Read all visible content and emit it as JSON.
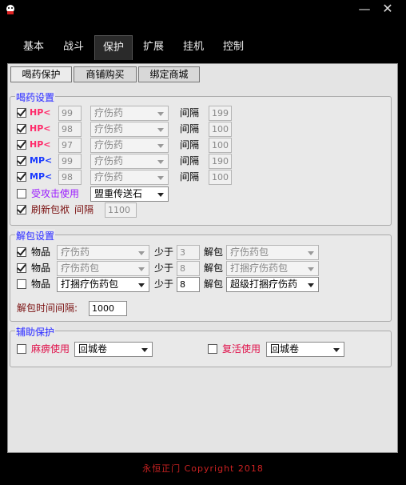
{
  "window": {
    "minimize_glyph": "—",
    "close_glyph": "✕"
  },
  "main_tabs": [
    "基本",
    "战斗",
    "保护",
    "扩展",
    "挂机",
    "控制"
  ],
  "sub_tabs": [
    "喝药保护",
    "商铺购买",
    "绑定商城"
  ],
  "potion": {
    "legend": "喝药设置",
    "interval_label": "间隔",
    "rows": [
      {
        "checked": true,
        "kind": "HP",
        "icon": "HP<",
        "threshold": "99",
        "item": "疗伤药",
        "interval": "199"
      },
      {
        "checked": true,
        "kind": "HP",
        "icon": "HP<",
        "threshold": "98",
        "item": "疗伤药",
        "interval": "100"
      },
      {
        "checked": true,
        "kind": "HP",
        "icon": "HP<",
        "threshold": "97",
        "item": "疗伤药",
        "interval": "100"
      },
      {
        "checked": true,
        "kind": "MP",
        "icon": "MP<",
        "threshold": "99",
        "item": "疗伤药",
        "interval": "190"
      },
      {
        "checked": true,
        "kind": "MP",
        "icon": "MP<",
        "threshold": "98",
        "item": "疗伤药",
        "interval": "100"
      }
    ],
    "attacked": {
      "checked": false,
      "label": "受攻击使用",
      "item": "盟重传送石"
    },
    "refresh": {
      "checked": true,
      "label": "刷新包袱",
      "interval_label": "间隔",
      "interval": "1100"
    }
  },
  "unpack": {
    "legend": "解包设置",
    "item_label": "物品",
    "less_label": "少于",
    "unpack_label": "解包",
    "rows": [
      {
        "checked": true,
        "item": "疗伤药",
        "count": "3",
        "pack": "疗伤药包",
        "enabled": false
      },
      {
        "checked": true,
        "item": "疗伤药包",
        "count": "8",
        "pack": "打捆疗伤药包",
        "enabled": false
      },
      {
        "checked": false,
        "item": "打捆疗伤药包",
        "count": "8",
        "pack": "超级打捆疗伤药",
        "enabled": true
      }
    ],
    "time_label": "解包时间间隔:",
    "time_value": "1000"
  },
  "assist": {
    "legend": "辅助保护",
    "paralysis": {
      "checked": false,
      "label": "麻痹使用",
      "item": "回城卷"
    },
    "revive": {
      "checked": false,
      "label": "复活使用",
      "item": "回城卷"
    }
  },
  "footer": "永恒正门  Copyright 2018",
  "colors": {
    "hp": "#ff2a6a",
    "mp": "#1a3aff",
    "legend": "#3a3aff",
    "attacked_label": "#9a1aff",
    "assist_label": "#e0104a"
  }
}
